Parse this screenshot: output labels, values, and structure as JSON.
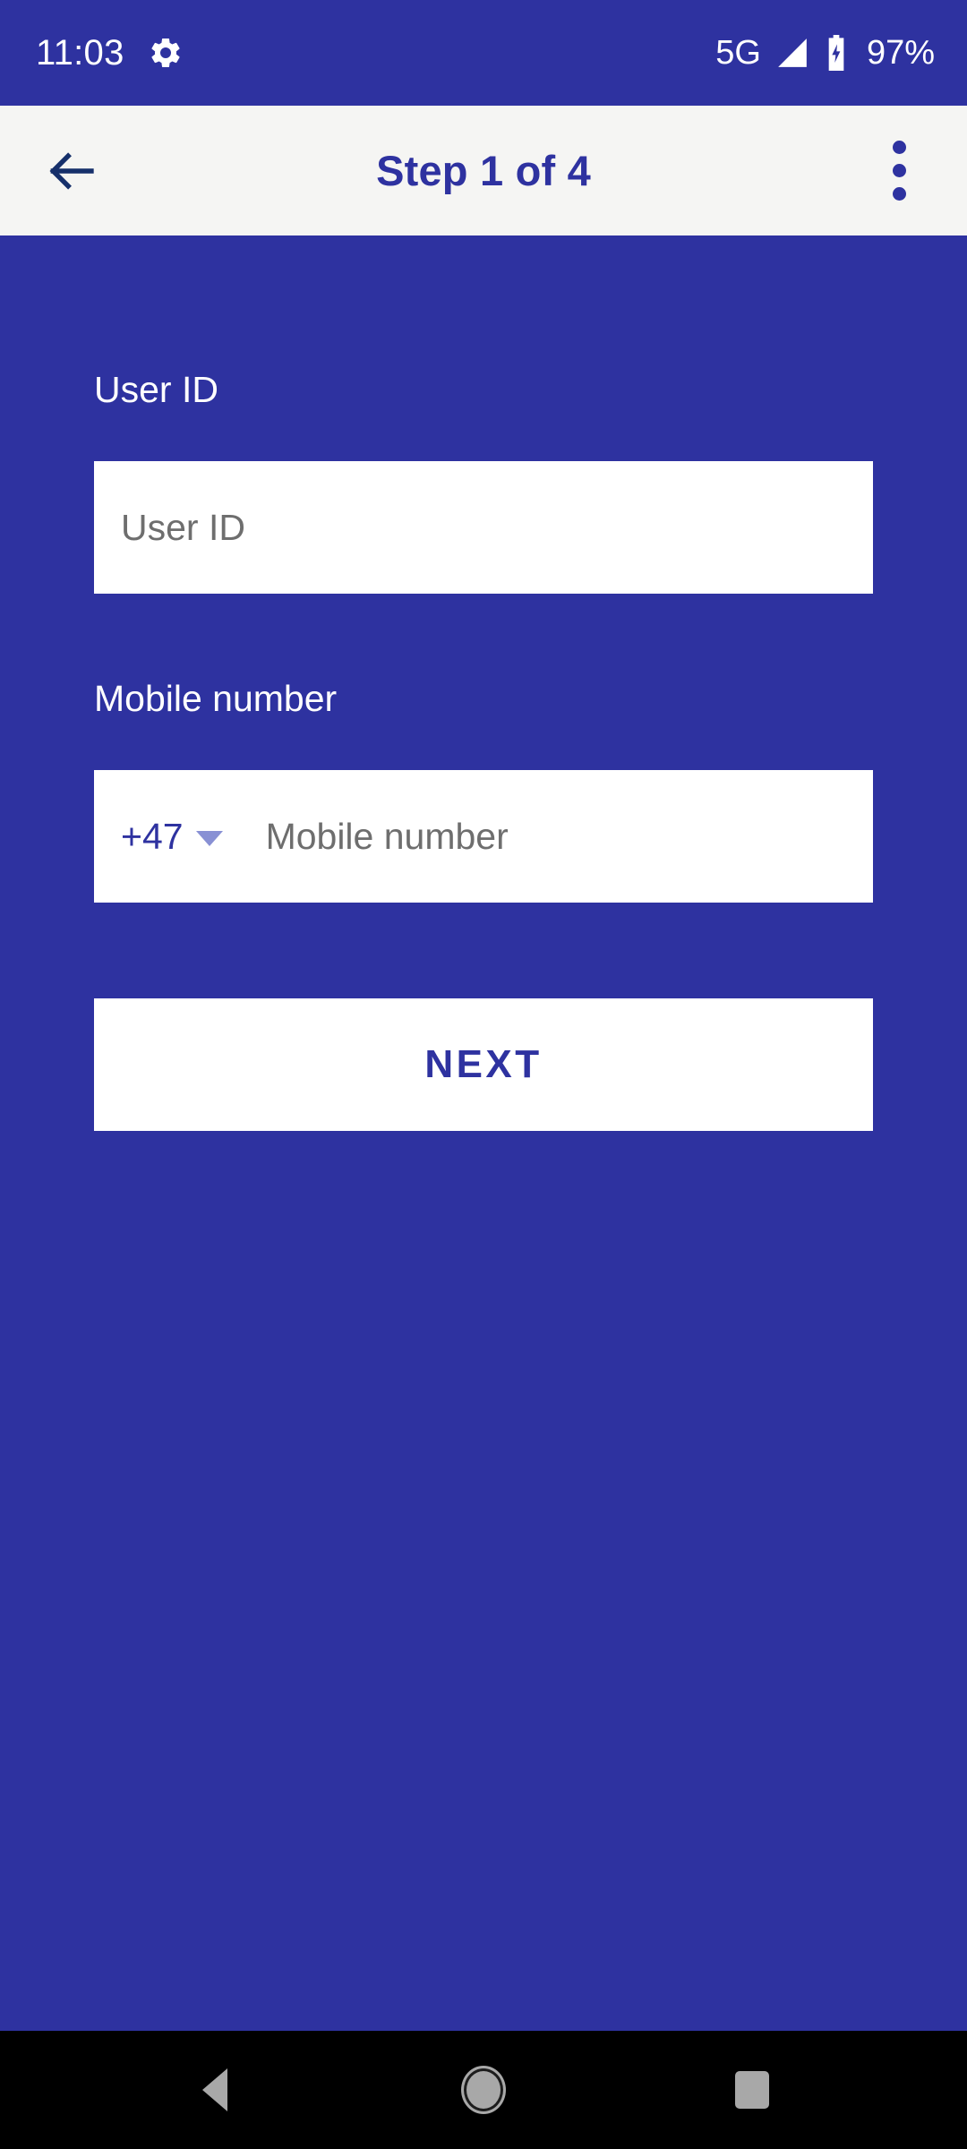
{
  "theme": {
    "primary_blue": "#2E32A0",
    "appbar_bg": "#F5F5F3",
    "field_bg": "#FFFFFF",
    "placeholder_gray": "#6E6E6E",
    "caret_lavender": "#8890D4",
    "navbar_bg": "#000000",
    "navbar_icon": "#A8A8A8"
  },
  "status_bar": {
    "time": "11:03",
    "settings_icon": "gear-icon",
    "network_type": "5G",
    "signal_icon": "signal-bars-icon",
    "battery_icon": "battery-charging-icon",
    "battery_percent": "97%"
  },
  "app_bar": {
    "back_icon": "arrow-left-icon",
    "title": "Step 1 of 4",
    "overflow_icon": "more-vertical-icon"
  },
  "form": {
    "user_id": {
      "label": "User ID",
      "placeholder": "User ID",
      "value": ""
    },
    "mobile_number": {
      "label": "Mobile number",
      "country_code": "+47",
      "dropdown_icon": "chevron-down-icon",
      "placeholder": "Mobile number",
      "value": ""
    },
    "next_button": {
      "label": "NEXT"
    }
  },
  "nav_bar": {
    "back": "nav-back-icon",
    "home": "nav-home-icon",
    "recents": "nav-recents-icon"
  }
}
